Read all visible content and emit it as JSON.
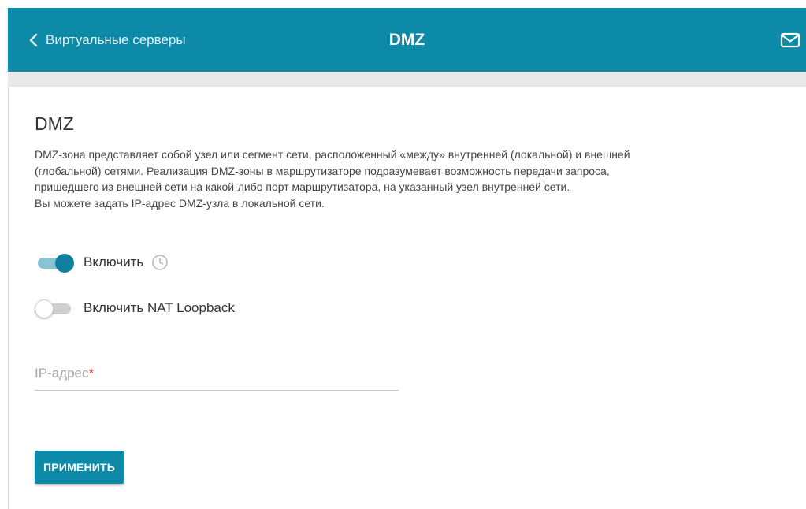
{
  "header": {
    "back_label": "Виртуальные серверы",
    "title": "DMZ",
    "background_color": "#0d8aa8"
  },
  "section": {
    "title": "DMZ",
    "description_lines": [
      "DMZ-зона представляет собой узел или сегмент сети, расположенный «между» внутренней (локальной) и внешней",
      "(глобальной) сетями. Реализация DMZ-зоны в маршрутизаторе подразумевает возможность передачи запроса,",
      "пришедшего из внешней сети на какой-либо порт маршрутизатора, на указанный узел внутренней сети.",
      "Вы можете задать IP-адрес DMZ-узла в локальной сети."
    ]
  },
  "toggles": {
    "enable": {
      "label": "Включить",
      "checked": true
    },
    "nat_loopback": {
      "label": "Включить NAT Loopback",
      "checked": false
    }
  },
  "ip_field": {
    "label": "IP-адрес",
    "required_mark": "*",
    "value": ""
  },
  "apply_button": {
    "label": "ПРИМЕНИТЬ"
  },
  "icons": {
    "back": "chevron-left-icon",
    "mail": "mail-icon",
    "schedule": "clock-icon"
  }
}
